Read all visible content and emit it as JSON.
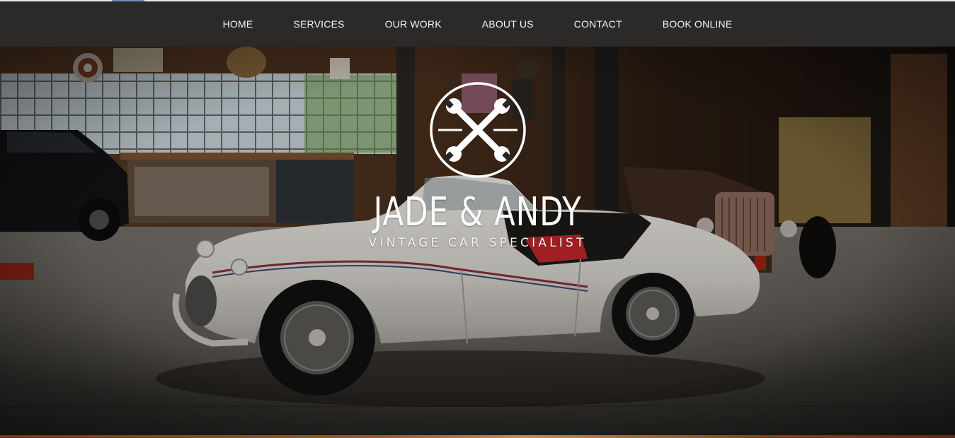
{
  "nav": {
    "items": [
      {
        "label": "HOME"
      },
      {
        "label": "SERVICES"
      },
      {
        "label": "OUR WORK"
      },
      {
        "label": "ABOUT US"
      },
      {
        "label": "CONTACT"
      },
      {
        "label": "BOOK ONLINE"
      }
    ]
  },
  "hero": {
    "brand_name": "JADE & ANDY",
    "tagline": "VINTAGE CAR SPECIALIST",
    "emblem_icon": "crossed-wrenches-icon"
  },
  "colors": {
    "nav_background": "#2b2a29",
    "nav_text": "#f3f3f3",
    "logo_text": "#ffffff",
    "car_body": "#d9d6d0"
  }
}
